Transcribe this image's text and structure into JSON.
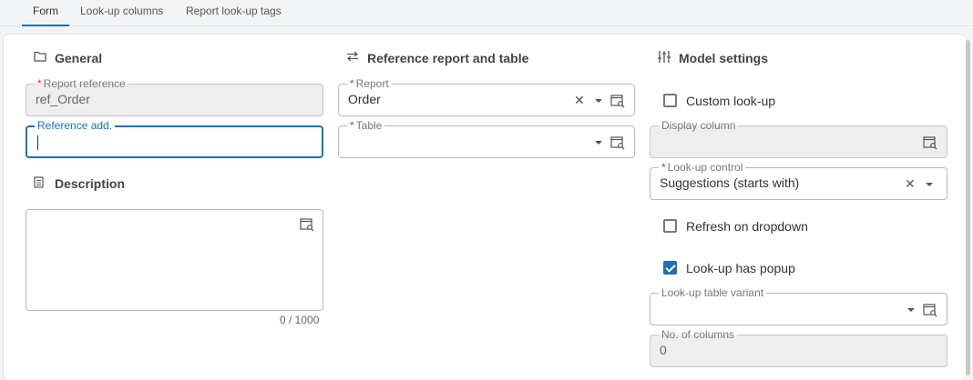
{
  "tabs": [
    "Form",
    "Look-up columns",
    "Report look-up tags"
  ],
  "general": {
    "title": "General",
    "report_reference": {
      "label": "Report reference",
      "value": "ref_Order"
    },
    "reference_add": {
      "label": "Reference add.",
      "value": ""
    }
  },
  "description": {
    "title": "Description",
    "value": "",
    "counter": "0 / 1000"
  },
  "reference": {
    "title": "Reference report and table",
    "report": {
      "label": "Report",
      "value": "Order"
    },
    "table": {
      "label": "Table",
      "value": ""
    }
  },
  "model": {
    "title": "Model settings",
    "custom_lookup": {
      "label": "Custom look-up",
      "checked": false
    },
    "display_column": {
      "label": "Display column",
      "value": ""
    },
    "lookup_control": {
      "label": "Look-up control",
      "value": "Suggestions (starts with)"
    },
    "refresh_on_dropdown": {
      "label": "Refresh on dropdown",
      "checked": false
    },
    "lookup_has_popup": {
      "label": "Look-up has popup",
      "checked": true
    },
    "lookup_table_variant": {
      "label": "Look-up table variant",
      "value": ""
    },
    "no_of_columns": {
      "label": "No. of columns",
      "value": "0"
    }
  },
  "colors": {
    "accent": "#1f6fb2",
    "required": "#d32f2f",
    "disabled_bg": "#eeeeee"
  }
}
